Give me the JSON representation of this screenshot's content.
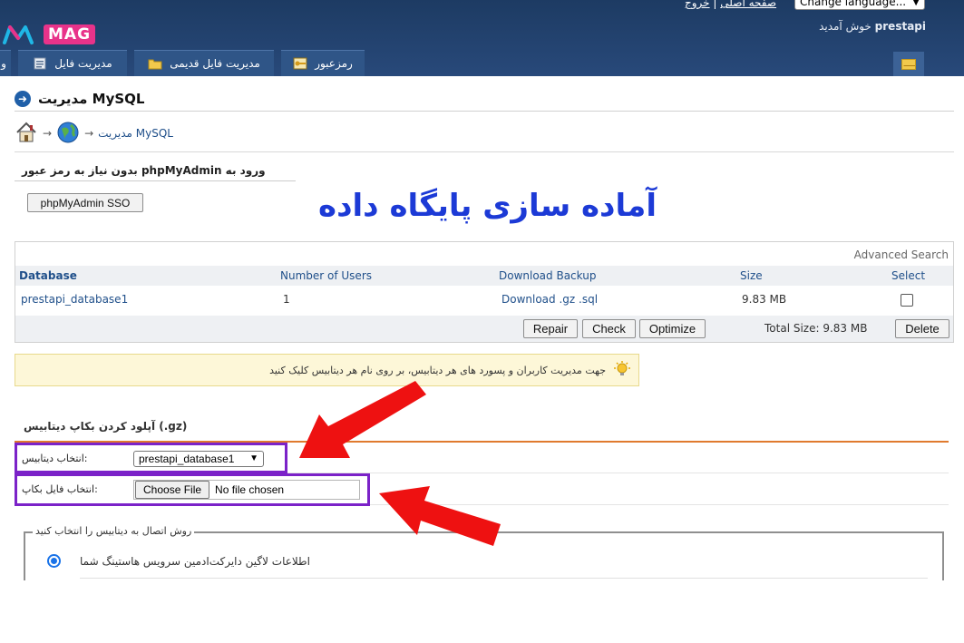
{
  "header": {
    "logo_text": "MAG",
    "top_links": {
      "home": "صفحه اصلی",
      "separator": "|",
      "logout": "خروج"
    },
    "language_select": "Change language...",
    "welcome_user": "prestapi",
    "welcome_text": "خوش آمدید",
    "nav_tabs": [
      {
        "label": "رمزعبور",
        "icon": "key-icon"
      },
      {
        "label": "مدیریت فایل قدیمی",
        "icon": "folder-icon"
      },
      {
        "label": "مدیریت فایل",
        "icon": "file-manager-icon"
      },
      {
        "label": "و",
        "icon": ""
      }
    ],
    "mail_icon": "mail-icon"
  },
  "page": {
    "title": "مدیریت MySQL",
    "breadcrumb_current": "مدیریت MySQL",
    "breadcrumb_arrow": "→"
  },
  "sso": {
    "label": "ورود به phpMyAdmin بدون نیاز به رمز عبور",
    "button": "phpMyAdmin SSO"
  },
  "overlay_title": "آماده سازی پایگاه داده",
  "database_table": {
    "advanced_search": "Advanced Search",
    "columns": [
      "Database",
      "Number of Users",
      "Download Backup",
      "Size",
      "Select"
    ],
    "rows": [
      {
        "database": "prestapi_database1",
        "users": "1",
        "backup": "Download .gz .sql",
        "size": "9.83 MB",
        "selected": false
      }
    ],
    "buttons": {
      "repair": "Repair",
      "check": "Check",
      "optimize": "Optimize",
      "delete": "Delete"
    },
    "total_size": "Total Size: 9.83 MB"
  },
  "notice": {
    "text": "جهت مدیریت کاربران و پسورد های هر دیتابیس، بر روی نام هر دیتابیس کلیک کنید"
  },
  "upload": {
    "title": "(gz.) آپلود کردن بکاپ دیتابیس",
    "select_db_label": ":انتخاب دیتابیس",
    "select_db_value": "prestapi_database1",
    "file_label": ":انتخاب فایل بکاپ",
    "choose_file": "Choose File",
    "no_file": "No file chosen",
    "connection_legend": "روش اتصال به دیتابیس را انتخاب کنید",
    "radio_option": "اطلاعات لاگین دایرکت‌ادمین سرویس هاستینگ شما"
  },
  "colors": {
    "header_bg": "#1d3b63",
    "nav_tab": "#2f5587",
    "link": "#1f4f8a",
    "overlay_title": "#1c3ad6",
    "highlight": "#7b22c8",
    "arrow": "#ee1111",
    "upload_rule": "#e07a2e",
    "logo_pink": "#e8338a"
  }
}
